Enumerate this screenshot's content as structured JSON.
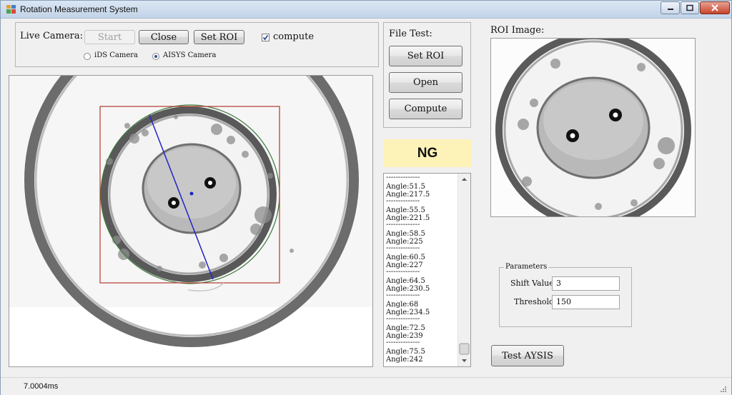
{
  "window": {
    "title": "Rotation Measurement System"
  },
  "live_camera": {
    "label": "Live Camera:",
    "start_label": "Start",
    "close_label": "Close",
    "set_roi_label": "Set ROI",
    "compute_label": "compute",
    "compute_checked": true,
    "cameras": [
      {
        "label": "iDS Camera",
        "selected": false
      },
      {
        "label": "AISYS Camera",
        "selected": true
      }
    ]
  },
  "file_test": {
    "label": "File Test:",
    "set_roi_label": "Set ROI",
    "open_label": "Open",
    "compute_label": "Compute"
  },
  "result": {
    "text": "NG",
    "color": "#fdf3b8"
  },
  "log": {
    "separator": "--------------",
    "entries": [
      {
        "a1": "Angle:51.5",
        "a2": "Angle:217.5"
      },
      {
        "a1": "Angle:55.5",
        "a2": "Angle:221.5"
      },
      {
        "a1": "Angle:58.5",
        "a2": "Angle:225"
      },
      {
        "a1": "Angle:60.5",
        "a2": "Angle:227"
      },
      {
        "a1": "Angle:64.5",
        "a2": "Angle:230.5"
      },
      {
        "a1": "Angle:68",
        "a2": "Angle:234.5"
      },
      {
        "a1": "Angle:72.5",
        "a2": "Angle:239"
      },
      {
        "a1": "Angle:75.5",
        "a2": "Angle:242"
      }
    ]
  },
  "roi": {
    "label": "ROI Image:"
  },
  "parameters": {
    "label": "Parameters",
    "shift_label": "Shift Value:",
    "shift_value": "3",
    "threshold_label": "Threshold:",
    "threshold_value": "150"
  },
  "test_button_label": "Test AYSIS",
  "status": {
    "elapsed": "7.0004ms"
  },
  "colors": {
    "roi_box": "#b13a2d",
    "axis_line": "#2323c8",
    "fit_circle": "#3a7a3a"
  }
}
